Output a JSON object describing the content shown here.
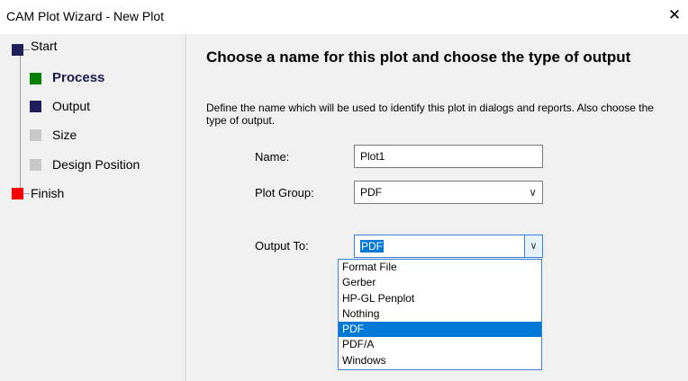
{
  "window": {
    "title": "CAM Plot  Wizard - New Plot",
    "close_glyph": "✕"
  },
  "sidebar": {
    "steps": [
      {
        "label": "Start",
        "color": "#1f1f5c"
      },
      {
        "label": "Process",
        "color": "#008000"
      },
      {
        "label": "Output",
        "color": "#1f1f5c"
      },
      {
        "label": "Size",
        "color": "#c8c8c8"
      },
      {
        "label": "Design Position",
        "color": "#c8c8c8"
      },
      {
        "label": "Finish",
        "color": "#ff0000"
      }
    ]
  },
  "main": {
    "heading": "Choose a name for this plot and choose the type of output",
    "description": "Define the name which will be used to identify this plot in dialogs and reports. Also choose the type of output.",
    "name_label": "Name:",
    "name_value": "Plot1",
    "group_label": "Plot Group:",
    "group_value": "PDF",
    "output_label": "Output To:",
    "output_value": "PDF",
    "output_options": [
      "Format File",
      "Gerber",
      "HP-GL Penplot",
      "Nothing",
      "PDF",
      "PDF/A",
      "Windows"
    ],
    "selected_option": "PDF"
  }
}
